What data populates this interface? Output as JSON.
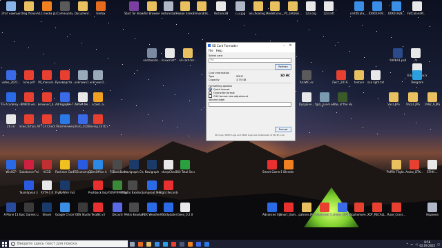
{
  "desktop_icons": [
    {
      "label": "Этот компьютер",
      "color": "#8ab4e8"
    },
    {
      "label": "Oleg Tronov",
      "color": "#e8c060"
    },
    {
      "label": "VLC media player",
      "color": "#f08020"
    },
    {
      "label": "Community",
      "color": "#5a5a5a"
    },
    {
      "label": "Document...",
      "color": "#e8c060"
    },
    {
      "label": "Firefox",
      "color": "#e66b1e"
    },
    {
      "label": "Start Tor Browser",
      "color": "#7a3fa0"
    },
    {
      "label": "Tor Browser",
      "color": "#e8c060"
    },
    {
      "label": "restore.bat",
      "color": "#b0b8c8"
    },
    {
      "label": "Новая папка",
      "color": "#e8c060"
    },
    {
      "label": "Flimanddis...",
      "color": "#e8c060"
    },
    {
      "label": "Yoctomi38",
      "color": "#e8e8e8"
    },
    {
      "label": "c.ui.jpg",
      "color": "#b0b8c8"
    },
    {
      "label": "ani_floating...",
      "color": "#e8c060"
    },
    {
      "label": "ModelConv...",
      "color": "#e8c060"
    },
    {
      "label": "VC_GAUGE...",
      "color": "#e8c060"
    },
    {
      "label": "123.otg",
      "color": "#e8e8e8"
    },
    {
      "label": "123.mtf",
      "color": "#e8e8e8"
    },
    {
      "label": "certificate_...",
      "color": "#3a8ee6"
    },
    {
      "label": "XXXO1919...",
      "color": "#3a8ee6"
    },
    {
      "label": "XXX01928...",
      "color": "#3a8ee6"
    },
    {
      "label": "FatColonsM... на xpreebdbc.txt",
      "color": "#e8e8e8"
    },
    {
      "label": "unetbootin...",
      "color": "#7a8aa0"
    },
    {
      "label": "linuxmint ...",
      "color": "#e8e8e8"
    },
    {
      "label": "sd-card-for...",
      "color": "#e8c060"
    },
    {
      "label": "7z",
      "color": "#e8e8e8"
    },
    {
      "label": "ЧАРКА1.psd",
      "color": "#2a4a8a"
    },
    {
      "label": "В.Батенков.txt",
      "color": "#e8e8e8"
    },
    {
      "label": "video_2022...",
      "color": "#3a6ae6"
    },
    {
      "label": "kino.pdf",
      "color": "#e84030"
    },
    {
      "label": "Mi_manual...",
      "color": "#e84030"
    },
    {
      "label": "Руководств... электроне...",
      "color": "#e84030"
    },
    {
      "label": "unknown1...",
      "color": "#9ab"
    },
    {
      "label": "unknown2...",
      "color": "#9ab"
    },
    {
      "label": "AnzWC.ec",
      "color": "#5a5a5a"
    },
    {
      "label": "Лист_2019...",
      "color": "#e84030"
    },
    {
      "label": "texture",
      "color": "#e8c060"
    },
    {
      "label": "sun light.txt",
      "color": "#e8e8e8"
    },
    {
      "label": "Telegram",
      "color": "#2aa0e0"
    },
    {
      "label": "FS Academy - Airline T...",
      "color": "#2a6ae6"
    },
    {
      "label": "BM600-ver...",
      "color": "#e84030"
    },
    {
      "label": "kenwood_b...",
      "color": "#e84030"
    },
    {
      "label": "AdrHjgkjKH-77(i).jpg",
      "color": "#3a6ae6"
    },
    {
      "label": "NASM-Ne...",
      "color": "#e8e8e8"
    },
    {
      "label": "scale1.ai",
      "color": "#f0a020"
    },
    {
      "label": "DysgiEne...",
      "color": "#e8e8e8"
    },
    {
      "label": "tgsk_panel.ec",
      "color": "#7a9ab0"
    },
    {
      "label": "Way of the Hunter",
      "color": "#3a5a2a"
    },
    {
      "label": "Vaca.JPG",
      "color": "#e8c060"
    },
    {
      "label": "Vaca1.JPG",
      "color": "#e8c060"
    },
    {
      "label": "1992_9.JPG",
      "color": "#e8c060"
    },
    {
      "label": "Z6.rar",
      "color": "#e8e8e8"
    },
    {
      "label": "ksee_fishon...",
      "color": "#e84030"
    },
    {
      "label": "WT C4 Checklist.pdf",
      "color": "#e84030"
    },
    {
      "label": "TeamViewer",
      "color": "#2a7ae6"
    },
    {
      "label": "photo_2022...",
      "color": "#3a6ae6"
    },
    {
      "label": "Boeing 247D on Wing42...",
      "color": "#e84030"
    },
    {
      "label": "WinSCP",
      "color": "#2a6ae6"
    },
    {
      "label": "Substance Painter 2019",
      "color": "#d02040"
    },
    {
      "label": "AC3D",
      "color": "#c03030"
    },
    {
      "label": "Rockstar Games ...",
      "color": "#f0c020"
    },
    {
      "label": "FSEconomy SimConnec...",
      "color": "#2a5ae0"
    },
    {
      "label": "OpenOffice 4.1.10",
      "color": "#2a8ae6"
    },
    {
      "label": "FSBackBox",
      "color": "#4a4a4a"
    },
    {
      "label": "Navigraph Charts D...",
      "color": "#1a3a6a"
    },
    {
      "label": "Navigraph",
      "color": "#1a3a6a"
    },
    {
      "label": "sharpChat",
      "color": "#e8e8e8"
    },
    {
      "label": "360 Total Security",
      "color": "#2aa040"
    },
    {
      "label": "Smart Game Booster",
      "color": "#e83030"
    },
    {
      "label": "Blender",
      "color": "#f08020"
    },
    {
      "label": "Pufflin Flight...",
      "color": "#e8c060"
    },
    {
      "label": "Avcbx_BTK...",
      "color": "#e84030"
    },
    {
      "label": "EFHK-...",
      "color": "#e8e8e8"
    },
    {
      "label": "Metro Exodus ...",
      "color": "#4a4a4a"
    },
    {
      "label": "Jumpseat Media Player",
      "color": "#2a6ae6"
    },
    {
      "label": "Flight Recorder",
      "color": "#e83030"
    },
    {
      "label": "Pushback Express",
      "color": "#e83030"
    },
    {
      "label": "FSXVFRMMapper",
      "color": "#3a8a3a"
    },
    {
      "label": "FlyByWire Installer",
      "color": "#1a3a6a"
    },
    {
      "label": "XVTA-1.0",
      "color": "#e8e8e8"
    },
    {
      "label": "TeamSpeak 3 Client",
      "color": "#2a5ae0"
    },
    {
      "label": "X-Plane 11",
      "color": "#2a4a9a"
    },
    {
      "label": "Epic Games Launcher",
      "color": "#3a3a3a"
    },
    {
      "label": "Steam",
      "color": "#1a3a6a"
    },
    {
      "label": "Google Chrome",
      "color": "#3a8ee6"
    },
    {
      "label": "OBS Studio",
      "color": "#3a3a3a"
    },
    {
      "label": "TeraBit v3",
      "color": "#e83030"
    },
    {
      "label": "Discord",
      "color": "#5a6ae6"
    },
    {
      "label": "Metro Exodus Enhanced",
      "color": "#4a4a4a"
    },
    {
      "label": "REX Weather Force 2020",
      "color": "#2a6ae6"
    },
    {
      "label": "ASGUpdater",
      "color": "#2a6ae6"
    },
    {
      "label": "Geex_0.2.0",
      "color": "#e8e8e8"
    },
    {
      "label": "Advanced SystemCare",
      "color": "#2a6ae6"
    },
    {
      "label": "Smart_Gam...",
      "color": "#e83030"
    },
    {
      "label": "patrons.JPG",
      "color": "#e8c060"
    },
    {
      "label": "Password_Y...",
      "color": "#e84030"
    },
    {
      "label": "photo_2021...",
      "color": "#3a6ae6"
    },
    {
      "label": "Sophomore...",
      "color": "#e84030"
    },
    {
      "label": "XOY_RECALL...",
      "color": "#e84030"
    },
    {
      "label": "Ruse_Cross...",
      "color": "#e84030"
    },
    {
      "label": "Корзина",
      "color": "#b0b8c8"
    }
  ],
  "dialog": {
    "title": "SD Card Formatter",
    "menu": [
      "File",
      "Help"
    ],
    "select_card_label": "Select card",
    "selected_drive": "F:\\",
    "refresh_label": "Refresh",
    "card_info_label": "Card information",
    "type_label": "Type",
    "type_value": "SDHC",
    "capacity_label": "Capacity",
    "capacity_value": "3.75 GB",
    "sd_logo": "SD HC",
    "formatting_label": "Formatting options",
    "quick_format": "Quick format",
    "overwrite_format": "Overwrite format",
    "chs_label": "CHS format size adjustment",
    "volume_label": "Volume label",
    "format_button": "Format",
    "footer": "SD Logo, SDHC Logo and SDXC Logo are trademarks of SD-3C, LLC."
  },
  "taskbar": {
    "search_placeholder": "Введите здесь текст для поиска",
    "apps": [
      {
        "name": "task-view",
        "color": "#9aa4b8"
      },
      {
        "name": "firefox",
        "color": "#e66b1e"
      },
      {
        "name": "file-explorer",
        "color": "#e8c060"
      },
      {
        "name": "chrome",
        "color": "#3a8ee6"
      },
      {
        "name": "telegram",
        "color": "#2aa0e0"
      },
      {
        "name": "media",
        "color": "#e84030"
      },
      {
        "name": "steam",
        "color": "#4a5a7a"
      },
      {
        "name": "blender",
        "color": "#f08020"
      },
      {
        "name": "app",
        "color": "#3a6ae6"
      },
      {
        "name": "app2",
        "color": "#2a7ae6"
      }
    ],
    "time": "8:56",
    "date": "02.09.2022"
  }
}
